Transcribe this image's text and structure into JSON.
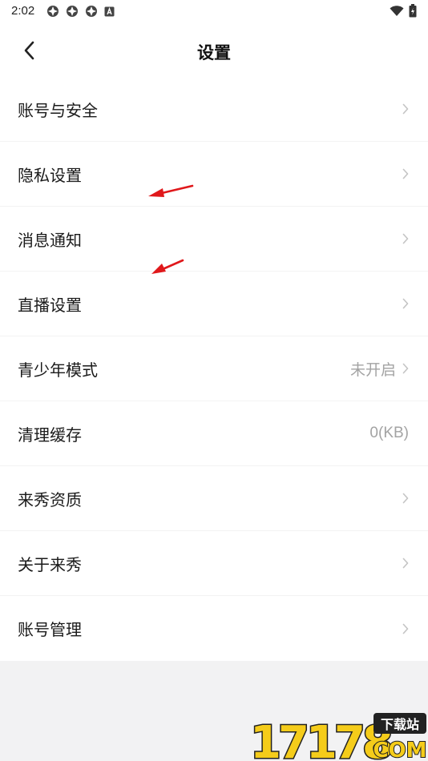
{
  "status_bar": {
    "time": "2:02",
    "left_icons": [
      "notification-icon",
      "notification-icon",
      "notification-icon",
      "a-badge-icon"
    ],
    "right_icons": [
      "wifi-icon",
      "battery-icon"
    ]
  },
  "header": {
    "back_icon": "chevron-left-icon",
    "title": "设置"
  },
  "settings": [
    {
      "label": "账号与安全",
      "value": "",
      "chevron": true
    },
    {
      "label": "隐私设置",
      "value": "",
      "chevron": true
    },
    {
      "label": "消息通知",
      "value": "",
      "chevron": true
    },
    {
      "label": "直播设置",
      "value": "",
      "chevron": true
    },
    {
      "label": "青少年模式",
      "value": "未开启",
      "chevron": true
    },
    {
      "label": "清理缓存",
      "value": "0(KB)",
      "chevron": false
    },
    {
      "label": "来秀资质",
      "value": "",
      "chevron": true
    },
    {
      "label": "关于来秀",
      "value": "",
      "chevron": true
    },
    {
      "label": "账号管理",
      "value": "",
      "chevron": true
    }
  ],
  "watermark": {
    "number": "17178",
    "badge": "下载站",
    "suffix": "COM"
  },
  "colors": {
    "background": "#f2f2f3",
    "surface": "#ffffff",
    "text_primary": "#1a1a1a",
    "text_secondary": "#a3a3a3",
    "annotation_arrow": "#e0181b",
    "watermark_yellow": "#f5cc1a"
  }
}
